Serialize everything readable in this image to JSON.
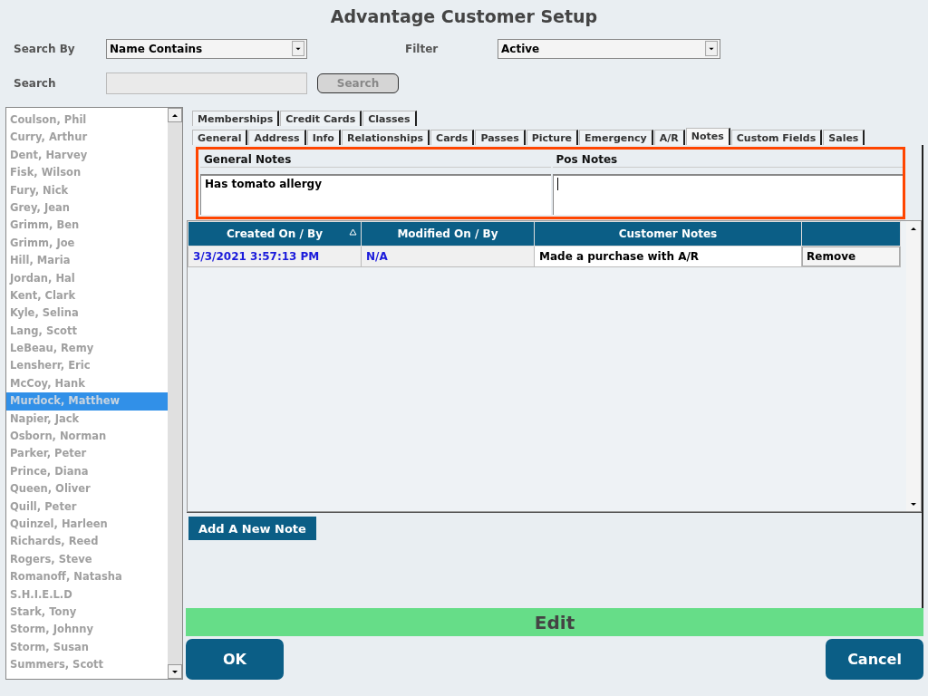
{
  "window": {
    "title": "Advantage Customer Setup"
  },
  "search": {
    "search_by_label": "Search By",
    "search_by_value": "Name Contains",
    "filter_label": "Filter",
    "filter_value": "Active",
    "search_label": "Search",
    "search_button": "Search"
  },
  "customers": [
    {
      "name": "Coulson, Phil",
      "selected": false
    },
    {
      "name": "Curry, Arthur",
      "selected": false
    },
    {
      "name": "Dent, Harvey",
      "selected": false
    },
    {
      "name": "Fisk, Wilson",
      "selected": false
    },
    {
      "name": "Fury, Nick",
      "selected": false
    },
    {
      "name": "Grey, Jean",
      "selected": false
    },
    {
      "name": "Grimm, Ben",
      "selected": false
    },
    {
      "name": "Grimm, Joe",
      "selected": false
    },
    {
      "name": "Hill, Maria",
      "selected": false
    },
    {
      "name": "Jordan, Hal",
      "selected": false
    },
    {
      "name": "Kent, Clark",
      "selected": false
    },
    {
      "name": "Kyle, Selina",
      "selected": false
    },
    {
      "name": "Lang, Scott",
      "selected": false
    },
    {
      "name": "LeBeau, Remy",
      "selected": false
    },
    {
      "name": "Lensherr, Eric",
      "selected": false
    },
    {
      "name": "McCoy, Hank",
      "selected": false
    },
    {
      "name": "Murdock, Matthew",
      "selected": true
    },
    {
      "name": "Napier, Jack",
      "selected": false
    },
    {
      "name": "Osborn, Norman",
      "selected": false
    },
    {
      "name": "Parker, Peter",
      "selected": false
    },
    {
      "name": "Prince, Diana",
      "selected": false
    },
    {
      "name": "Queen, Oliver",
      "selected": false
    },
    {
      "name": "Quill, Peter",
      "selected": false
    },
    {
      "name": "Quinzel, Harleen",
      "selected": false
    },
    {
      "name": "Richards, Reed",
      "selected": false
    },
    {
      "name": "Rogers, Steve",
      "selected": false
    },
    {
      "name": "Romanoff, Natasha",
      "selected": false
    },
    {
      "name": "S.H.I.E.L.D",
      "selected": false
    },
    {
      "name": "Stark, Tony",
      "selected": false
    },
    {
      "name": "Storm, Johnny",
      "selected": false
    },
    {
      "name": "Storm, Susan",
      "selected": false
    },
    {
      "name": "Summers, Scott",
      "selected": false
    }
  ],
  "tab_rows": [
    [
      {
        "label": "Memberships",
        "selected": false
      },
      {
        "label": "Credit Cards",
        "selected": false
      },
      {
        "label": "Classes",
        "selected": false
      }
    ],
    [
      {
        "label": "General",
        "selected": false
      },
      {
        "label": "Address",
        "selected": false
      },
      {
        "label": "Info",
        "selected": false
      },
      {
        "label": "Relationships",
        "selected": false
      },
      {
        "label": "Cards",
        "selected": false
      },
      {
        "label": "Passes",
        "selected": false
      },
      {
        "label": "Picture",
        "selected": false
      },
      {
        "label": "Emergency",
        "selected": false
      },
      {
        "label": "A/R",
        "selected": false
      },
      {
        "label": "Notes",
        "selected": true
      },
      {
        "label": "Custom Fields",
        "selected": false
      },
      {
        "label": "Sales",
        "selected": false
      }
    ]
  ],
  "notes": {
    "general_label": "General Notes",
    "general_value": "Has tomato allergy",
    "pos_label": "Pos Notes"
  },
  "table": {
    "columns": [
      "Created On / By",
      "Modified On / By",
      "Customer Notes"
    ],
    "rows": [
      {
        "created": "3/3/2021 3:57:13 PM",
        "modified": "N/A",
        "note": "Made a purchase with A/R",
        "action": "Remove"
      }
    ]
  },
  "add_note_button": "Add A New Note",
  "edit_bar": "Edit",
  "buttons": {
    "ok": "OK",
    "cancel": "Cancel"
  }
}
